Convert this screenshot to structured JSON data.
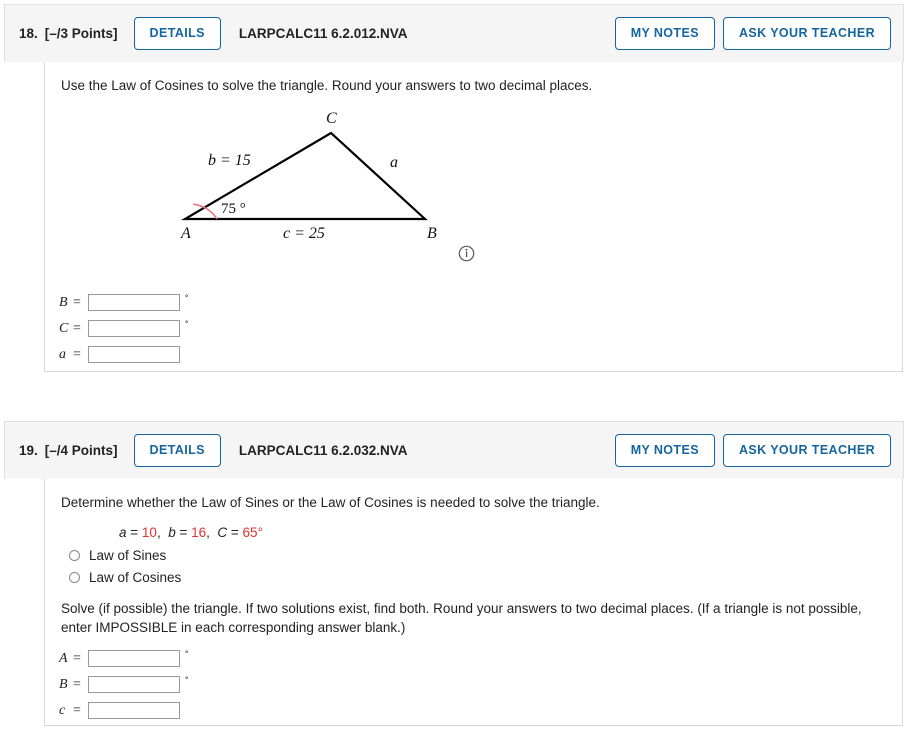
{
  "problems": [
    {
      "number": "18.",
      "points": "[–/3 Points]",
      "details_label": "DETAILS",
      "code": "LARPCALC11 6.2.012.NVA",
      "my_notes_label": "MY NOTES",
      "ask_teacher_label": "ASK YOUR TEACHER",
      "prompt": "Use the Law of Cosines to solve the triangle. Round your answers to two decimal places.",
      "figure": {
        "vertex_a": "A",
        "vertex_b": "B",
        "vertex_c": "C",
        "side_b": "b = 15",
        "side_a": "a",
        "side_c": "c = 25",
        "angle_a": "75 °",
        "info_icon": "info-icon",
        "arc_color": "#e8737d"
      },
      "answers": [
        {
          "var": "B",
          "eq": "=",
          "value": "",
          "placeholder": "",
          "unit": "°"
        },
        {
          "var": "C",
          "eq": "=",
          "value": "",
          "placeholder": "",
          "unit": "°"
        },
        {
          "var": "a",
          "eq": "=",
          "value": "",
          "placeholder": "",
          "unit": ""
        }
      ]
    },
    {
      "number": "19.",
      "points": "[–/4 Points]",
      "details_label": "DETAILS",
      "code": "LARPCALC11 6.2.032.NVA",
      "my_notes_label": "MY NOTES",
      "ask_teacher_label": "ASK YOUR TEACHER",
      "prompt": "Determine whether the Law of Sines or the Law of Cosines is needed to solve the triangle.",
      "given": {
        "a_var": "a",
        "a_eq": " = ",
        "a_val": "10",
        "sep1": ",  ",
        "b_var": "b",
        "b_eq": " = ",
        "b_val": "16",
        "sep2": ",  ",
        "c_var": "C",
        "c_eq": " = ",
        "c_val": "65°"
      },
      "options": [
        {
          "label": "Law of Sines",
          "selected": false
        },
        {
          "label": "Law of Cosines",
          "selected": false
        }
      ],
      "prompt2": "Solve (if possible) the triangle. If two solutions exist, find both. Round your answers to two decimal places. (If a triangle is not possible, enter IMPOSSIBLE in each corresponding answer blank.)",
      "answers": [
        {
          "var": "A",
          "eq": "=",
          "value": "",
          "placeholder": "",
          "unit": "°"
        },
        {
          "var": "B",
          "eq": "=",
          "value": "",
          "placeholder": "",
          "unit": "°"
        },
        {
          "var": "c",
          "eq": "=",
          "value": "",
          "placeholder": "",
          "unit": ""
        }
      ]
    }
  ],
  "colors": {
    "accent_blue": "#1565a0",
    "header_gray": "#f5f5f5",
    "given_red": "#e03030",
    "arc_red": "#e8737d"
  }
}
